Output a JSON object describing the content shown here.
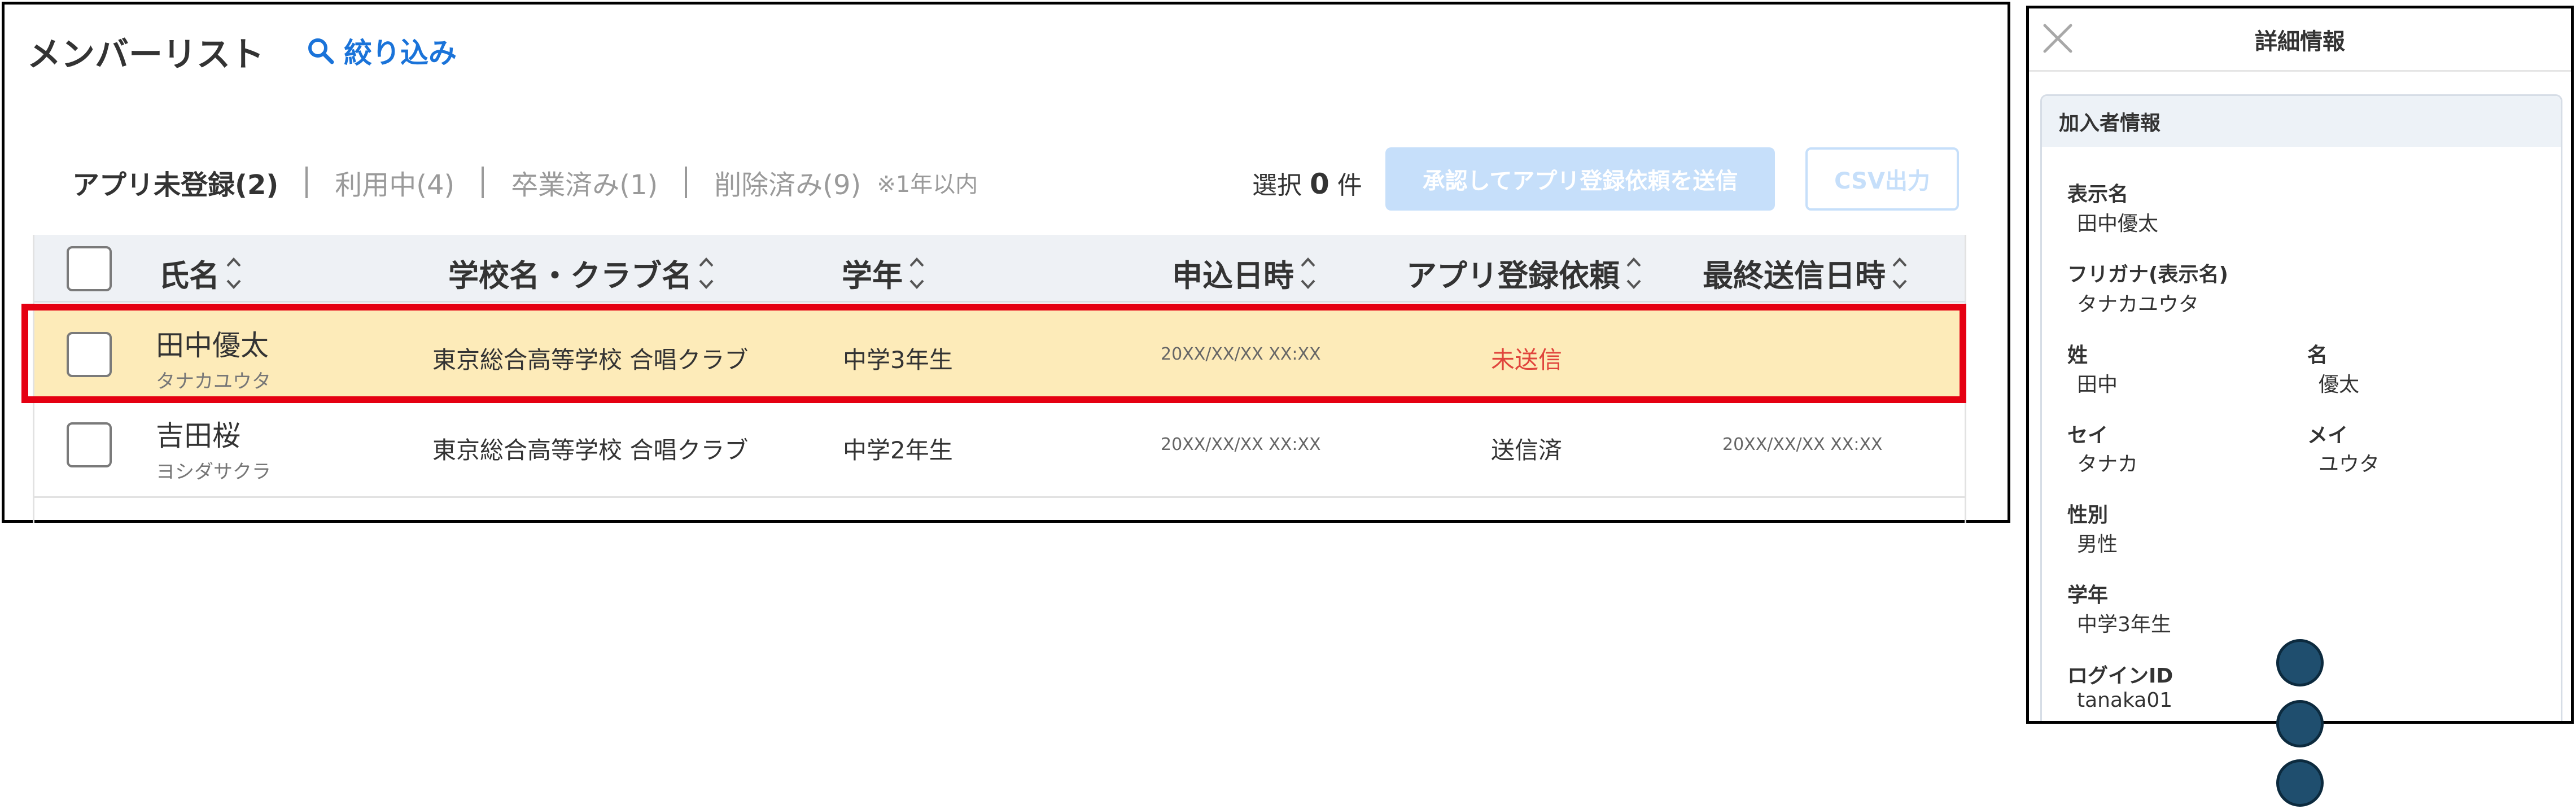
{
  "list": {
    "title": "メンバーリスト",
    "filter_label": "絞り込み",
    "tabs": [
      {
        "label": "アプリ未登録(2)",
        "active": true
      },
      {
        "label": "利用中(4)",
        "active": false
      },
      {
        "label": "卒業済み(1)",
        "active": false
      },
      {
        "label": "削除済み(9)",
        "active": false
      }
    ],
    "tab_note": "※1年以内",
    "selection": {
      "prefix": "選択",
      "count": "0",
      "suffix": "件"
    },
    "approve_button": "承認してアプリ登録依頼を送信",
    "csv_button": "CSV出力",
    "columns": [
      "氏名",
      "学校名・クラブ名",
      "学年",
      "申込日時",
      "アプリ登録依頼",
      "最終送信日時"
    ],
    "rows": [
      {
        "name": "田中優太",
        "kana": "タナカユウタ",
        "school": "東京総合高等学校 合唱クラブ",
        "grade": "中学3年生",
        "applied_at": "20XX/XX/XX XX:XX",
        "request_status": "未送信",
        "last_sent": "",
        "highlighted": true
      },
      {
        "name": "吉田桜",
        "kana": "ヨシダサクラ",
        "school": "東京総合高等学校 合唱クラブ",
        "grade": "中学2年生",
        "applied_at": "20XX/XX/XX XX:XX",
        "request_status": "送信済",
        "last_sent": "20XX/XX/XX XX:XX",
        "highlighted": false
      }
    ]
  },
  "detail": {
    "title": "詳細情報",
    "section_title": "加入者情報",
    "fields": {
      "display_name": {
        "label": "表示名",
        "value": "田中優太"
      },
      "furigana": {
        "label": "フリガナ(表示名)",
        "value": "タナカユウタ"
      },
      "last_name": {
        "label": "姓",
        "value": "田中"
      },
      "first_name": {
        "label": "名",
        "value": "優太"
      },
      "last_name_kana": {
        "label": "セイ",
        "value": "タナカ"
      },
      "first_name_kana": {
        "label": "メイ",
        "value": "ユウタ"
      },
      "gender": {
        "label": "性別",
        "value": "男性"
      },
      "grade": {
        "label": "学年",
        "value": "中学3年生"
      },
      "login_id": {
        "label": "ログインID",
        "value": "tanaka01"
      }
    }
  },
  "colors": {
    "accent": "#1a73d9",
    "button_disabled": "#c6dffa",
    "highlight_row": "#fdebb9",
    "highlight_border": "#e50012",
    "unsent_text": "#e0443c",
    "dot": "#1f4e6e"
  },
  "icons": {
    "filter": "search-icon",
    "sort": "sort-icon",
    "close": "close-icon"
  }
}
